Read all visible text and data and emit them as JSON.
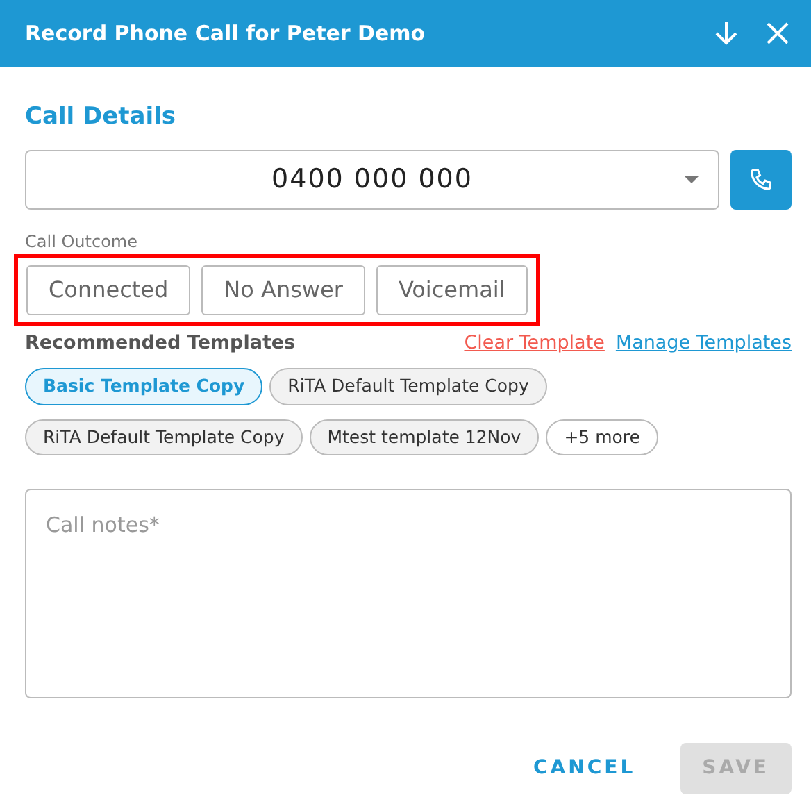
{
  "window": {
    "title": "Record Phone Call for Peter Demo"
  },
  "section_title": "Call Details",
  "phone_select": {
    "value": "0400 000 000"
  },
  "call_outcome": {
    "label": "Call Outcome",
    "highlighted": true,
    "options": [
      {
        "label": "Connected",
        "selected": false
      },
      {
        "label": "No Answer",
        "selected": false
      },
      {
        "label": "Voicemail",
        "selected": false
      }
    ]
  },
  "templates": {
    "title": "Recommended Templates",
    "links": [
      {
        "label": "Clear Template",
        "kind": "danger"
      },
      {
        "label": "Manage Templates",
        "kind": "primary"
      }
    ],
    "chips": [
      {
        "label": "Basic Template Copy",
        "selected": true,
        "kind": "template"
      },
      {
        "label": "RiTA Default Template Copy",
        "selected": false,
        "kind": "template"
      },
      {
        "label": "RiTA Default Template Copy",
        "selected": false,
        "kind": "template"
      },
      {
        "label": "Mtest template 12Nov",
        "selected": false,
        "kind": "template"
      },
      {
        "label": "+5 more",
        "selected": false,
        "kind": "more"
      }
    ]
  },
  "notes": {
    "placeholder": "Call notes*"
  },
  "buttons": [
    {
      "label": "CANCEL",
      "disabled": false,
      "kind": "text"
    },
    {
      "label": "SAVE",
      "disabled": true,
      "kind": "filled"
    }
  ]
}
